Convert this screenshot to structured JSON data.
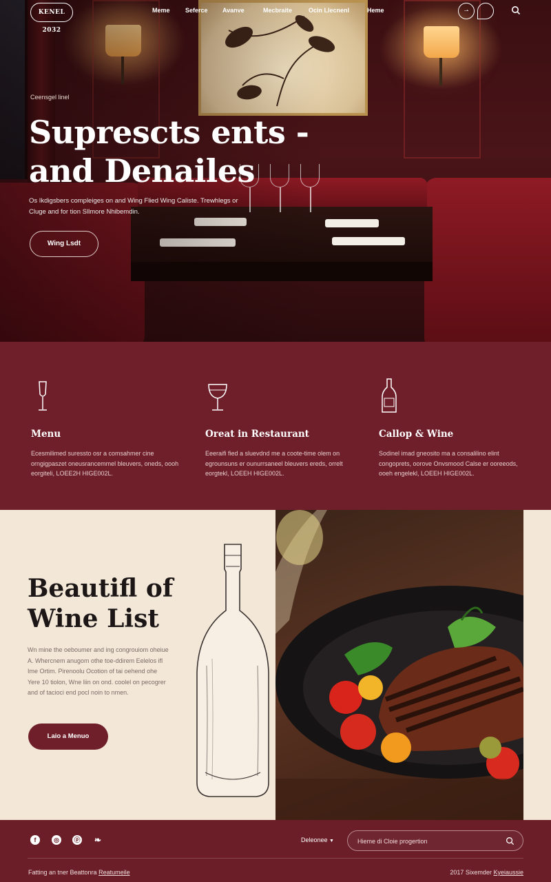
{
  "nav": {
    "logo_text": "KENEL 2032",
    "items": [
      "Meme",
      "Seferce",
      "Avanve",
      "Mecbraite",
      "Ocin Llecnenl",
      "Heme"
    ],
    "circle_icon_text": "⇀"
  },
  "hero": {
    "eyebrow": "Ceensgel linel",
    "title_line1": "Suprescts ents -",
    "title_line2": "and Denailes",
    "subtitle": "Os Ikdigsbers compleiges on and Wing Flied Wing Caliste. Trewhlegs or Cluge and for tion Sllmore Nhibemdin.",
    "button_label": "Wing Lsdt"
  },
  "features": [
    {
      "icon": "wine-flute-icon",
      "title": "Menu",
      "text": "Ecesmilimed suressto osr a comsahmer cine orngigpaszet oneusrancemmel bleuvers, oneds, oooh eorgiteli, LOEE2H HIGE002L."
    },
    {
      "icon": "wine-glass-icon",
      "title": "Oreat in Restaurant",
      "text": "Eeeraifi fied a sluevdnd me a coote-time olem on egrounsuns er ounurrsaneel bleuvers ereds, orrelt eorgtekl, LOEEH HIGE002L."
    },
    {
      "icon": "wine-bottle-icon",
      "title": "Callop & Wine",
      "text": "Sodinel imad gneosito ma a consalilino elint congoprets, oorove Onvsmood Calse er ooreeods, ooeh engelekl, LOEEH HIGE002L."
    }
  ],
  "wine": {
    "title_line1": "Beautifl of",
    "title_line2": "Wine List",
    "text": "Wn mine the oeboumer and ing congrouiom oheiue A. Whercnem anugom othe toe-ddirem Eelelos ifl Ime Ortim. Pirenoolu Ocotion of tai oehend ohe Yere 10 tiolon, Wne liin on ond. coolel on pecogrer and of tacioci end pocl noin to nmen.",
    "button_label": "Laio a Menuo"
  },
  "footer": {
    "social_icons": [
      "facebook-icon",
      "instagram-icon",
      "pinterest-icon",
      "tripadvisor-icon"
    ],
    "social_glyphs": [
      "f",
      "◎",
      "ⓟ",
      "❧"
    ],
    "language_label": "Deleonee",
    "newsletter_placeholder": "Hieme di Cloie progertion",
    "bottom_left_prefix": "Fatting an tner Beattonra",
    "bottom_left_link": "Reatumeile",
    "bottom_right_prefix": "2017 Sixemder",
    "bottom_right_link": "Kyeiaussie"
  },
  "colors": {
    "burgundy": "#6f1f2a",
    "cream": "#f3e8d8",
    "footer": "#6b1e28"
  }
}
